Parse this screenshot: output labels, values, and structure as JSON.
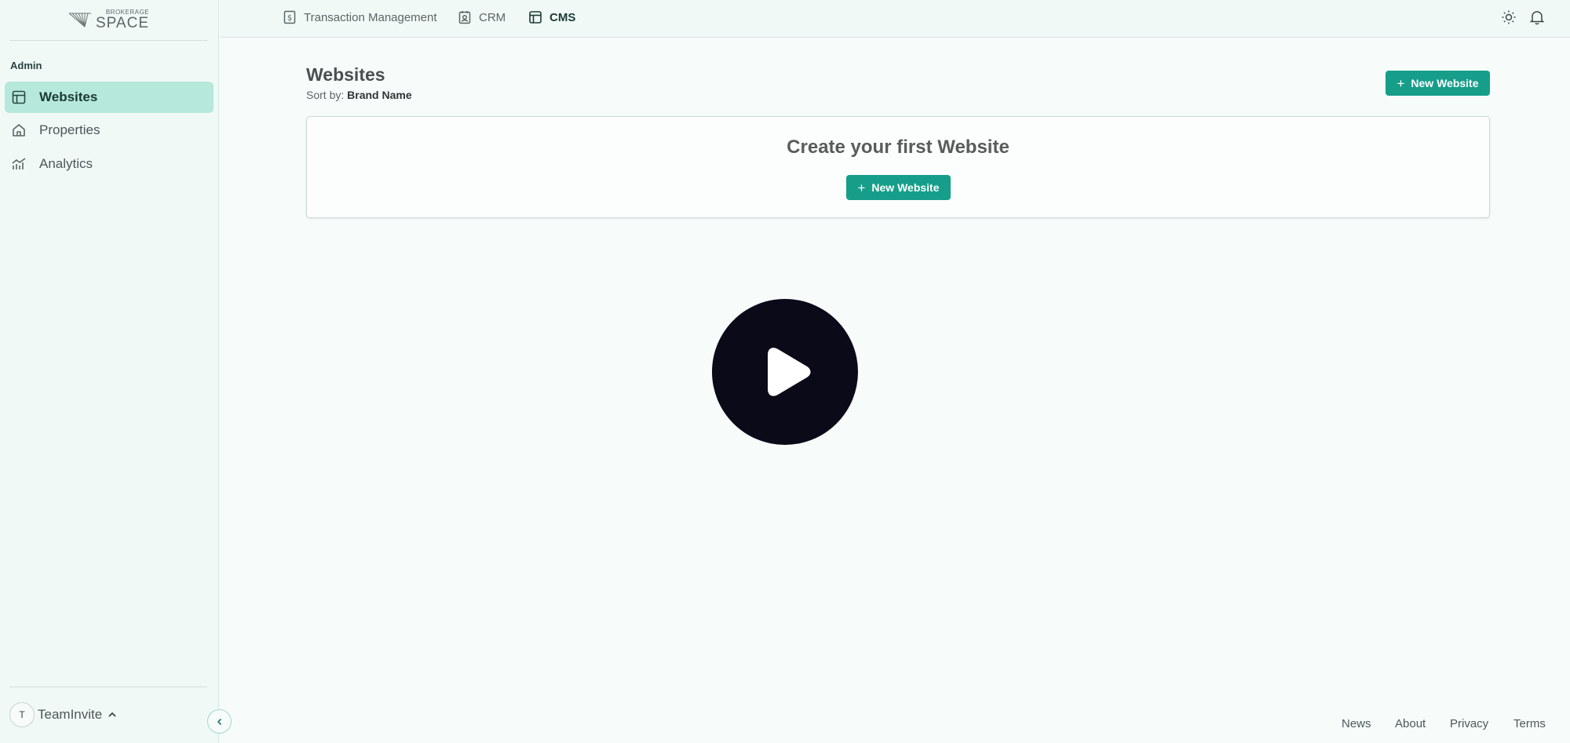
{
  "brand": {
    "small": "BROKERAGE",
    "big": "SPACE"
  },
  "sidebar": {
    "section": "Admin",
    "items": [
      {
        "label": "Websites",
        "icon": "layout-icon",
        "active": true
      },
      {
        "label": "Properties",
        "icon": "home-icon",
        "active": false
      },
      {
        "label": "Analytics",
        "icon": "chart-icon",
        "active": false
      }
    ],
    "user": {
      "initial": "T",
      "name": "TeamInvite"
    }
  },
  "topnav": {
    "tabs": [
      {
        "label": "Transaction Management",
        "icon": "dollar-doc-icon"
      },
      {
        "label": "CRM",
        "icon": "contact-badge-icon"
      },
      {
        "label": "CMS",
        "icon": "layout-icon",
        "active": true
      }
    ]
  },
  "main": {
    "title": "Websites",
    "sort_label": "Sort by:",
    "sort_value": "Brand Name",
    "new_button": "New Website",
    "empty_title": "Create your first Website",
    "empty_button": "New Website"
  },
  "footer": {
    "links": [
      "News",
      "About",
      "Privacy",
      "Terms"
    ]
  },
  "colors": {
    "accent": "#169e8a",
    "active_bg": "#b7e8dc",
    "play_bg": "#0b0a18"
  }
}
